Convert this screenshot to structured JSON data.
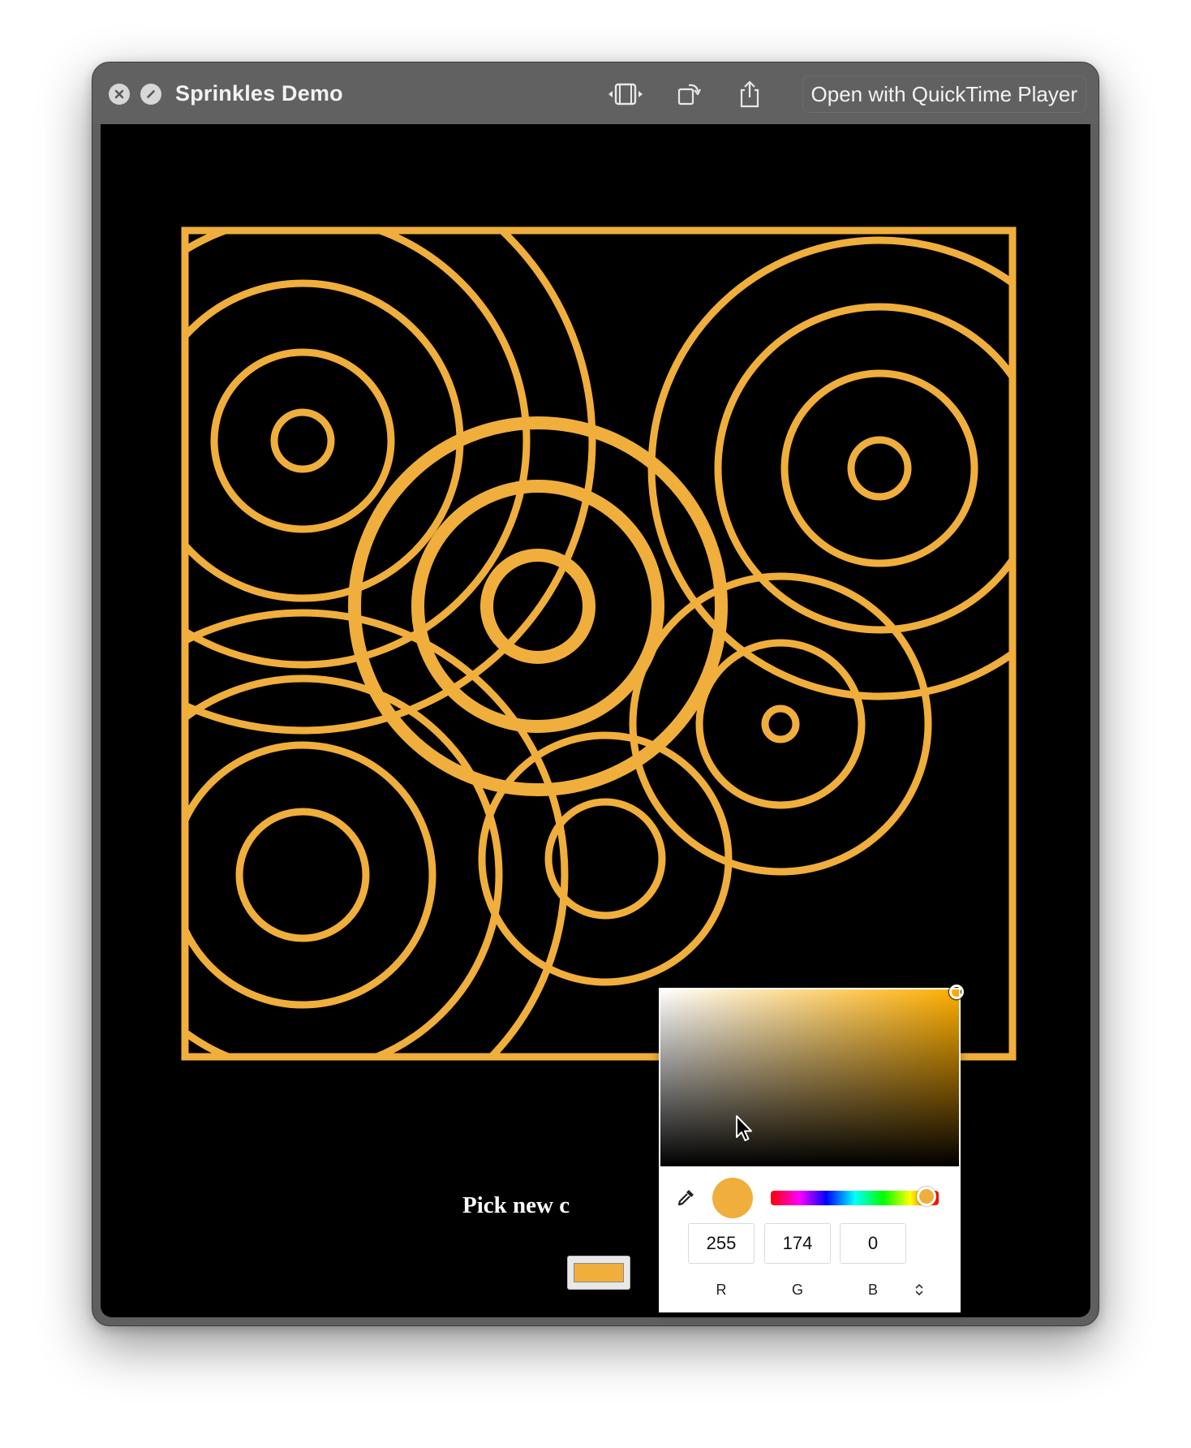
{
  "window": {
    "title": "Sprinkles Demo",
    "open_button_label": "Open with QuickTime Player"
  },
  "colors": {
    "stroke": "#f0ae3c",
    "background": "#000000",
    "titlebar": "#616161"
  },
  "toolbar_icons": [
    "close-icon",
    "stop-icon",
    "trim-icon",
    "rotate-icon",
    "share-icon"
  ],
  "page": {
    "prompt_label": "Pick new c"
  },
  "color_picker": {
    "hex": "#f0ae3c",
    "channels": [
      {
        "label": "R",
        "value": "255"
      },
      {
        "label": "G",
        "value": "174"
      },
      {
        "label": "B",
        "value": "0"
      }
    ]
  }
}
